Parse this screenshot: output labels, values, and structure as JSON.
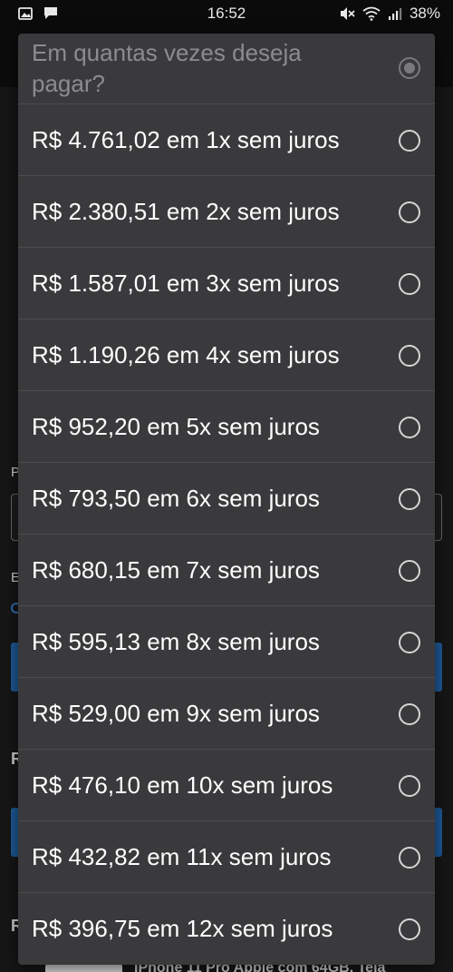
{
  "status_bar": {
    "time": "16:52",
    "battery": "38%",
    "icons": [
      "image-icon",
      "message-icon",
      "mute-icon",
      "wifi-icon",
      "signal-icon"
    ]
  },
  "background_page": {
    "letters": [
      "P",
      "E",
      "R",
      "R"
    ],
    "product_text": "iPhone 11 Pro Apple com 64GB, Tela",
    "accent_color": "#1e5a96"
  },
  "dialog": {
    "title": "Em quantas vezes deseja pagar?",
    "options": [
      {
        "label": "R$ 4.761,02 em 1x sem juros",
        "selected": false
      },
      {
        "label": "R$ 2.380,51 em 2x sem juros",
        "selected": false
      },
      {
        "label": "R$ 1.587,01 em 3x sem juros",
        "selected": false
      },
      {
        "label": "R$ 1.190,26 em 4x sem juros",
        "selected": false
      },
      {
        "label": "R$ 952,20 em 5x sem juros",
        "selected": false
      },
      {
        "label": "R$ 793,50 em 6x sem juros",
        "selected": false
      },
      {
        "label": "R$ 680,15 em 7x sem juros",
        "selected": false
      },
      {
        "label": "R$ 595,13 em 8x sem juros",
        "selected": false
      },
      {
        "label": "R$ 529,00 em 9x sem juros",
        "selected": false
      },
      {
        "label": "R$ 476,10 em 10x sem juros",
        "selected": false
      },
      {
        "label": "R$ 432,82 em 11x sem juros",
        "selected": false
      },
      {
        "label": "R$ 396,75 em 12x sem juros",
        "selected": false
      }
    ]
  }
}
